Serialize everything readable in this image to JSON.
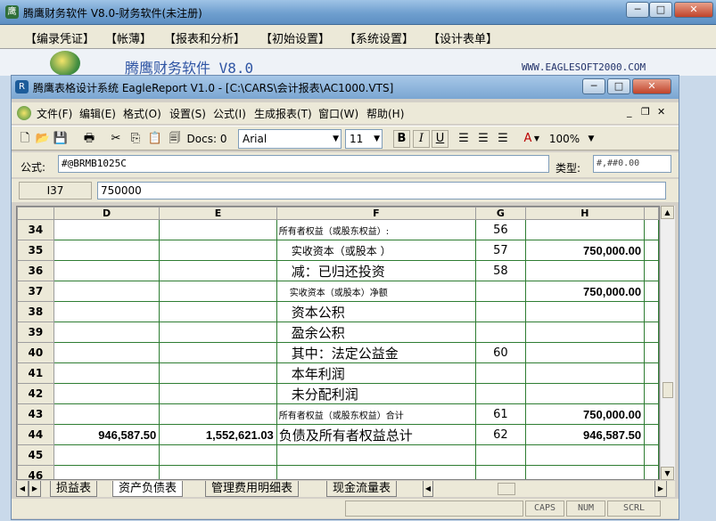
{
  "outer_window": {
    "title": "腾鹰财务软件 V8.0-财务软件(未注册)",
    "minimize": "─",
    "maximize": "□",
    "close": "✕"
  },
  "outer_menu": [
    "【编录凭证】",
    "【帐薄】",
    "【报表和分析】",
    "【初始设置】",
    "【系统设置】",
    "【设计表单】"
  ],
  "brand": {
    "name": "腾鹰财务软件 V8.0",
    "url": "WWW.EAGLESOFT2000.COM"
  },
  "inner_window": {
    "title": "腾鹰表格设计系统 EagleReport V1.0 - [C:\\CARS\\会计报表\\AC1000.VTS]",
    "minimize": "─",
    "maximize": "□",
    "close": "✕"
  },
  "inner_menu": [
    "文件(F)",
    "编辑(E)",
    "格式(O)",
    "设置(S)",
    "公式(I)",
    "生成报表(T)",
    "窗口(W)",
    "帮助(H)"
  ],
  "toolbar": {
    "docs_label": "Docs: 0",
    "font": "Arial",
    "font_size": "11",
    "bold": "B",
    "italic": "I",
    "underline": "U",
    "zoom": "100%"
  },
  "formula": {
    "label": "公式:",
    "value": "#@BRMB1025C",
    "type_label": "类型:",
    "type_value": "#,##0.00"
  },
  "cell": {
    "ref": "I37",
    "value": "750000"
  },
  "grid": {
    "columns": [
      "D",
      "E",
      "F",
      "G",
      "H"
    ],
    "rows": [
      {
        "n": "34",
        "d": "",
        "e": "",
        "f": "所有者权益（或股东权益）:",
        "fs": "small",
        "g": "56",
        "h": ""
      },
      {
        "n": "35",
        "d": "",
        "e": "",
        "f": "实收资本（或股本     ）",
        "fs": "mid",
        "g": "57",
        "h": "750,000.00"
      },
      {
        "n": "36",
        "d": "",
        "e": "",
        "f": "减：已归还投资",
        "fs": "big",
        "g": "58",
        "h": ""
      },
      {
        "n": "37",
        "d": "",
        "e": "",
        "f": "实收资本（或股本）净额",
        "fs": "smallind",
        "g": "",
        "h": "750,000.00"
      },
      {
        "n": "38",
        "d": "",
        "e": "",
        "f": "资本公积",
        "fs": "big",
        "g": "",
        "h": ""
      },
      {
        "n": "39",
        "d": "",
        "e": "",
        "f": "盈余公积",
        "fs": "big",
        "g": "",
        "h": ""
      },
      {
        "n": "40",
        "d": "",
        "e": "",
        "f": "其中：法定公益金",
        "fs": "big",
        "g": "60",
        "h": ""
      },
      {
        "n": "41",
        "d": "",
        "e": "",
        "f": "本年利润",
        "fs": "big",
        "g": "",
        "h": ""
      },
      {
        "n": "42",
        "d": "",
        "e": "",
        "f": "未分配利润",
        "fs": "big",
        "g": "",
        "h": ""
      },
      {
        "n": "43",
        "d": "",
        "e": "",
        "f": "所有者权益（或股东权益）合计",
        "fs": "small",
        "g": "61",
        "h": "750,000.00"
      },
      {
        "n": "44",
        "d": "946,587.50",
        "e": "1,552,621.03",
        "f": "负债及所有者权益总计",
        "fs": "big2",
        "g": "62",
        "h": "946,587.50"
      },
      {
        "n": "45",
        "d": "",
        "e": "",
        "f": "",
        "fs": "small",
        "g": "",
        "h": ""
      },
      {
        "n": "46",
        "d": "",
        "e": "",
        "f": "",
        "fs": "small",
        "g": "",
        "h": ""
      }
    ]
  },
  "sheet_tabs": [
    "损益表",
    "资产负债表",
    "管理费用明细表",
    "现金流量表"
  ],
  "active_tab": "资产负债表",
  "status": {
    "caps": "CAPS",
    "num": "NUM",
    "scrl": "SCRL"
  }
}
